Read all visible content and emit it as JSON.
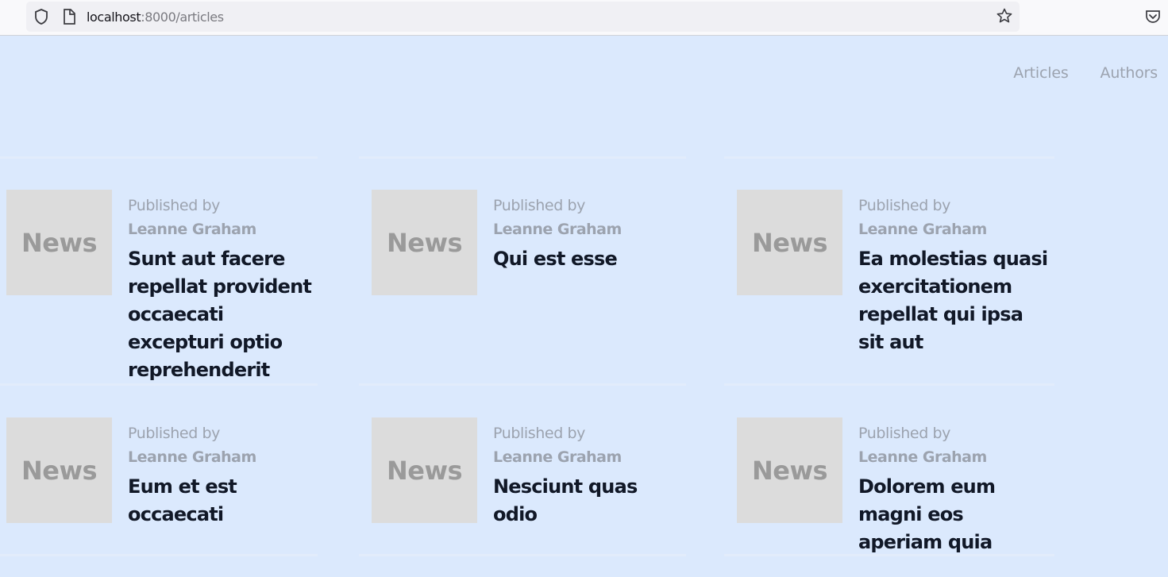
{
  "browser": {
    "url_host": "localhost",
    "url_path": ":8000/articles"
  },
  "nav": {
    "items": [
      "Articles",
      "Authors"
    ]
  },
  "articles": [
    {
      "thumb": "News",
      "published_by": "Published by",
      "author": "Leanne Graham",
      "title": "Sunt aut facere repellat provident occaecati excepturi optio reprehenderit"
    },
    {
      "thumb": "News",
      "published_by": "Published by",
      "author": "Leanne Graham",
      "title": "Qui est esse"
    },
    {
      "thumb": "News",
      "published_by": "Published by",
      "author": "Leanne Graham",
      "title": "Ea molestias quasi exercitationem repellat qui ipsa sit aut"
    },
    {
      "thumb": "News",
      "published_by": "Published by",
      "author": "Leanne Graham",
      "title": "Eum et est occaecati"
    },
    {
      "thumb": "News",
      "published_by": "Published by",
      "author": "Leanne Graham",
      "title": "Nesciunt quas odio"
    },
    {
      "thumb": "News",
      "published_by": "Published by",
      "author": "Leanne Graham",
      "title": "Dolorem eum magni eos aperiam quia"
    }
  ],
  "colors": {
    "page_bg": "#dbe9fd",
    "muted_text": "#9ca3af",
    "title_text": "#111827",
    "thumb_bg": "#dcdcdc"
  }
}
